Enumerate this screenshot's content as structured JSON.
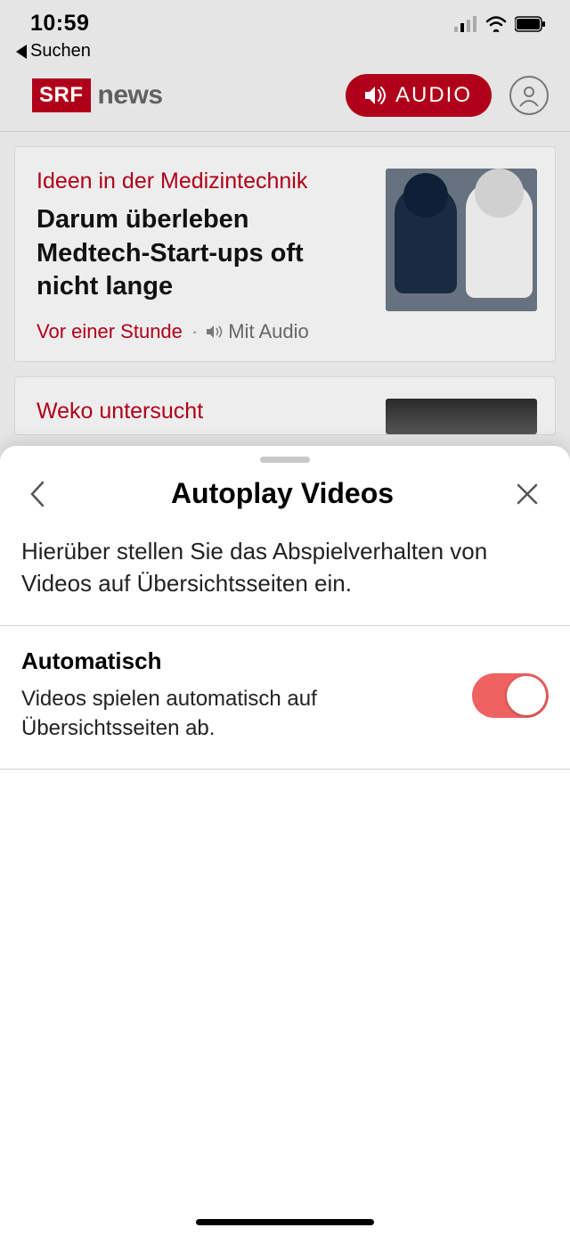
{
  "status": {
    "time": "10:59",
    "back": "Suchen"
  },
  "header": {
    "brand": "SRF",
    "brand_sub": "news",
    "audio_label": "AUDIO"
  },
  "articles": [
    {
      "kicker": "Ideen in der Medizintechnik",
      "title": "Darum überleben Medtech-Start-ups oft nicht lange",
      "time": "Vor einer Stunde",
      "audio": "Mit Audio"
    },
    {
      "kicker": "Weko untersucht"
    }
  ],
  "sheet": {
    "title": "Autoplay Videos",
    "desc": "Hierüber stellen Sie das Abspielverhalten von Videos auf Übersichtsseiten ein.",
    "setting_label": "Automatisch",
    "setting_sub": "Videos spielen automatisch auf Übersichtsseiten ab."
  }
}
